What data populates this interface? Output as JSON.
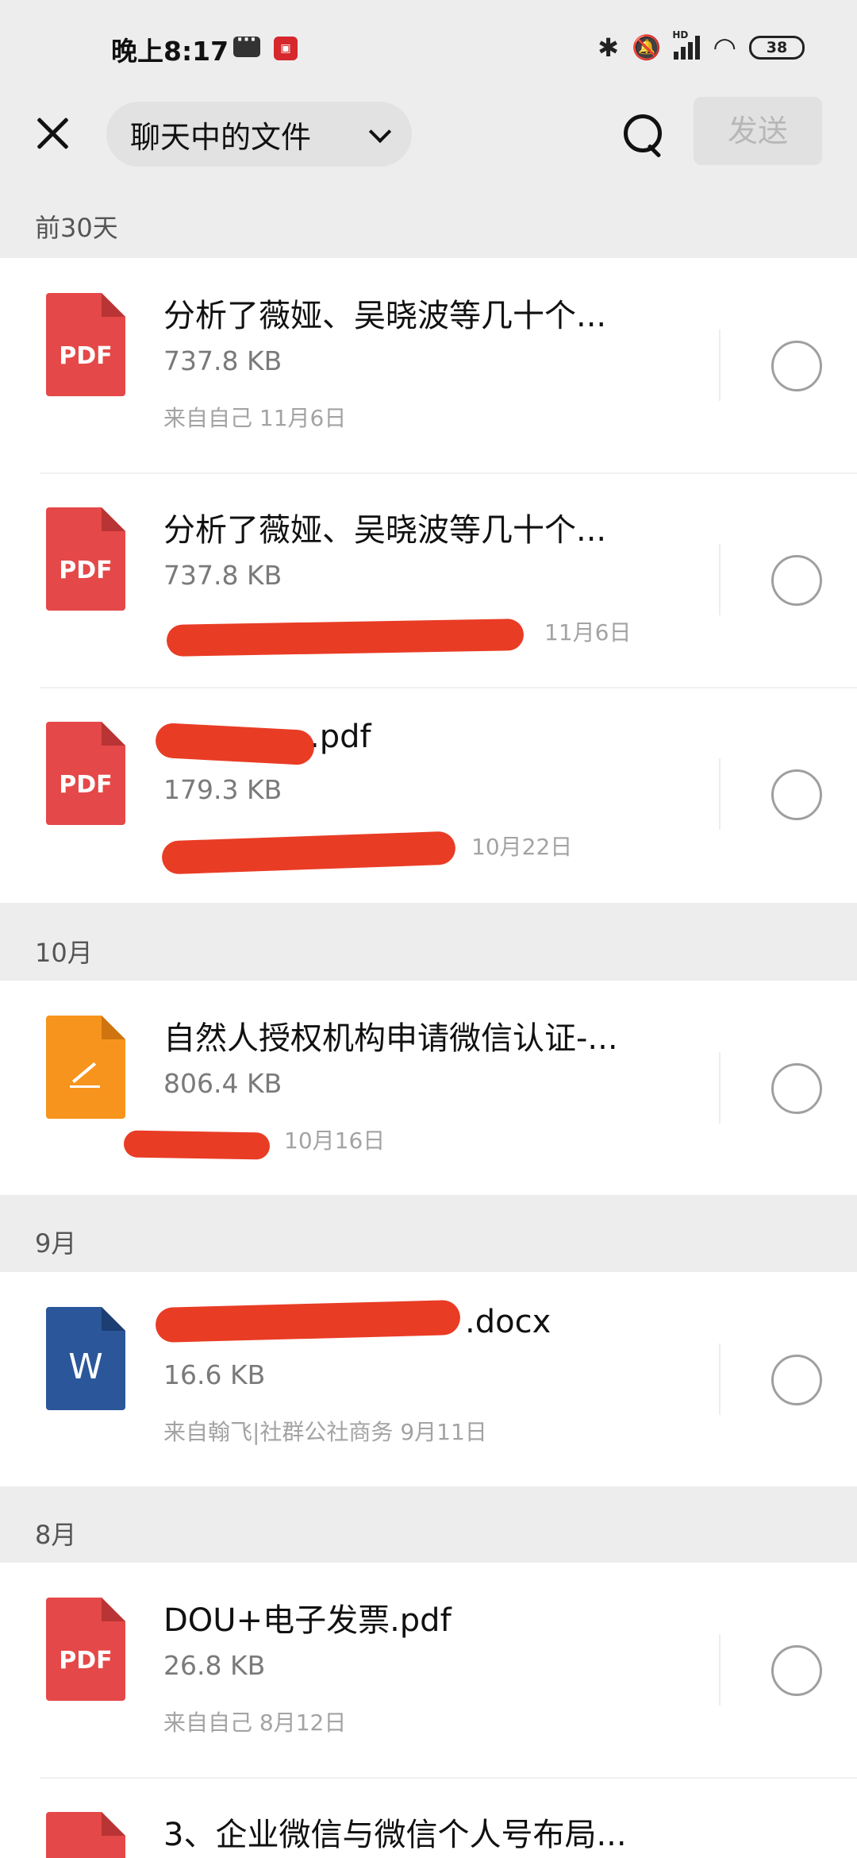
{
  "status_bar": {
    "time": "晚上8:17",
    "signal_label": "HD",
    "battery": "38"
  },
  "header": {
    "title": "聊天中的文件",
    "send_label": "发送"
  },
  "sections": [
    {
      "label": "前30天",
      "files": [
        {
          "type": "pdf",
          "icon_label": "PDF",
          "name": "分析了薇娅、吴晓波等几十个...",
          "size": "737.8 KB",
          "meta": "来自自己  11月6日"
        },
        {
          "type": "pdf",
          "icon_label": "PDF",
          "name": "分析了薇娅、吴晓波等几十个...",
          "size": "737.8 KB",
          "meta_date": "11月6日"
        },
        {
          "type": "pdf",
          "icon_label": "PDF",
          "name_suffix": ".pdf",
          "size": "179.3 KB",
          "meta_date": "10月22日"
        }
      ]
    },
    {
      "label": "10月",
      "files": [
        {
          "type": "note",
          "name": "自然人授权机构申请微信认证-...",
          "size": "806.4 KB",
          "meta_date": "10月16日"
        }
      ]
    },
    {
      "label": "9月",
      "files": [
        {
          "type": "word",
          "icon_label": "W",
          "name_suffix": ".docx",
          "size": "16.6 KB",
          "meta": "来自翰飞|社群公社商务  9月11日"
        }
      ]
    },
    {
      "label": "8月",
      "files": [
        {
          "type": "pdf",
          "icon_label": "PDF",
          "name": "DOU+电子发票.pdf",
          "size": "26.8 KB",
          "meta": "来自自己  8月12日"
        },
        {
          "type": "pdf",
          "name": "3、企业微信与微信个人号布局..."
        }
      ]
    }
  ],
  "colors": {
    "pdf": "#e54848",
    "note": "#f7941d",
    "word": "#2b579a",
    "background": "#ededed",
    "redaction": "#e8341c"
  }
}
